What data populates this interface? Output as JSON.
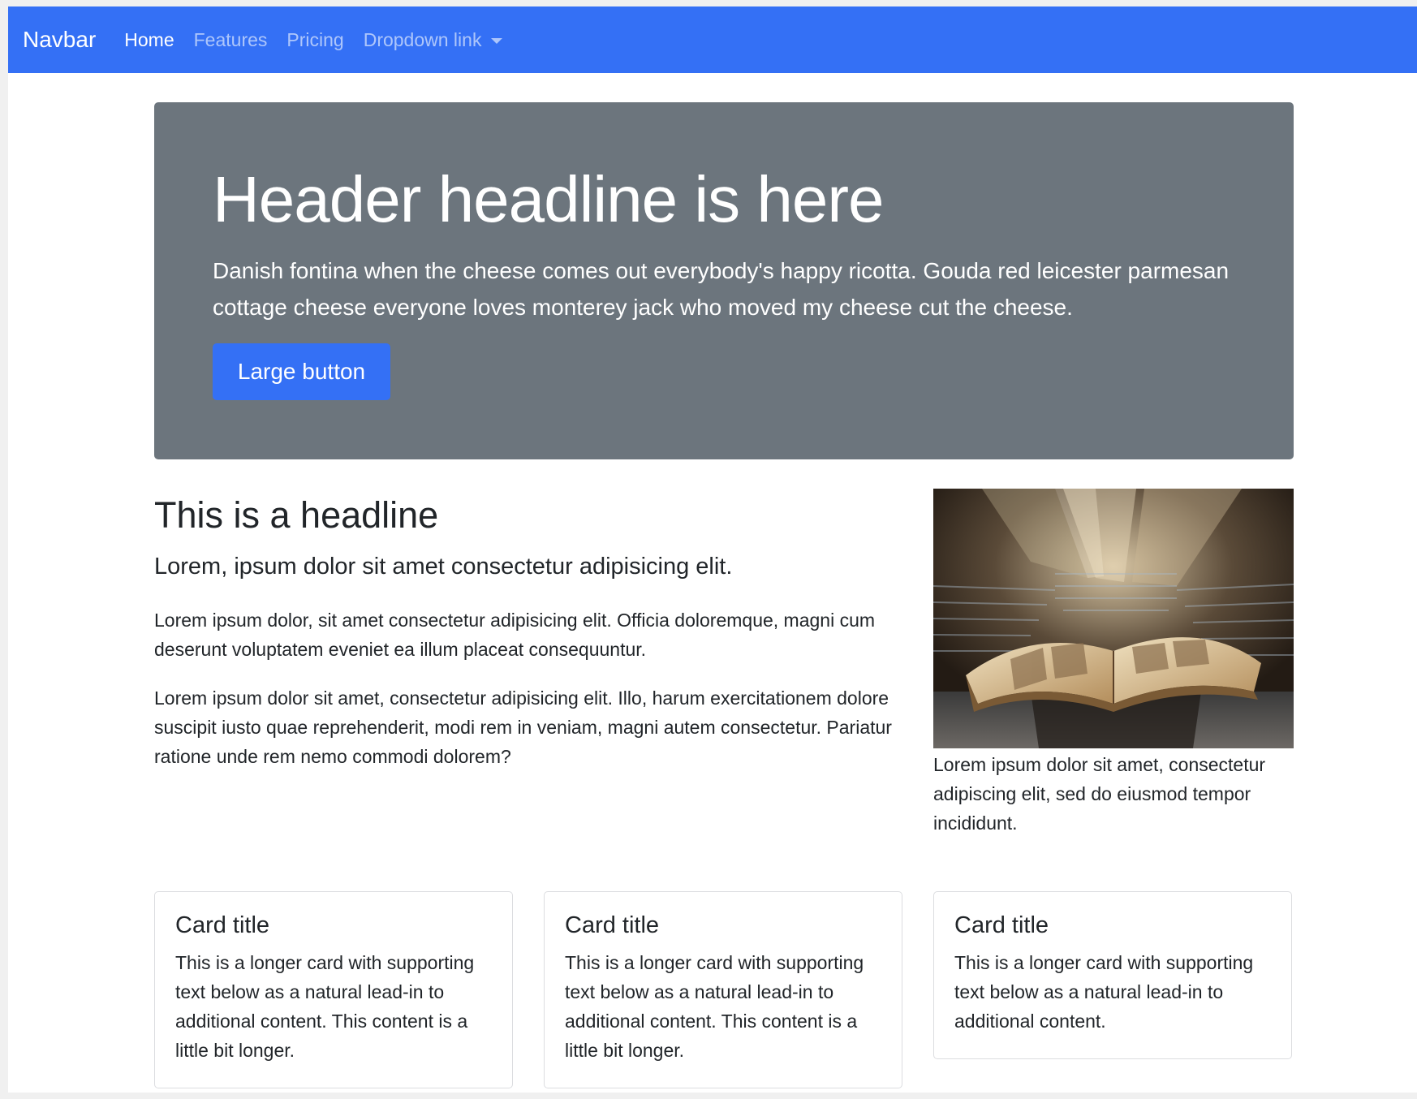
{
  "navbar": {
    "brand": "Navbar",
    "background_color": "#3470f5",
    "links": [
      {
        "label": "Home",
        "active": true
      },
      {
        "label": "Features",
        "active": false
      },
      {
        "label": "Pricing",
        "active": false
      },
      {
        "label": "Dropdown link",
        "active": false,
        "dropdown": true
      }
    ],
    "dropdown_icon": "caret-down-icon"
  },
  "hero": {
    "title": "Header headline is here",
    "lead": "Danish fontina when the cheese comes out everybody's happy ricotta. Gouda red leicester parmesan cottage cheese everyone loves monterey jack who moved my cheese cut the cheese.",
    "button_label": "Large button",
    "background_color": "#6c757d"
  },
  "article": {
    "headline": "This is a headline",
    "lead": "Lorem, ipsum dolor sit amet consectetur adipisicing elit.",
    "paragraphs": [
      "Lorem ipsum dolor, sit amet consectetur adipisicing elit. Officia doloremque, magni cum deserunt voluptatem eveniet ea illum placeat consequuntur.",
      "Lorem ipsum dolor sit amet, consectetur adipisicing elit. Illo, harum exercitationem dolore suscipit iusto quae reprehenderit, modi rem in veniam, magni autem consectetur. Pariatur ratione unde rem nemo commodi dolorem?"
    ]
  },
  "figure": {
    "image": "open-book-photo",
    "caption": "Lorem ipsum dolor sit amet, consectetur adipiscing elit, sed do eiusmod tempor incididunt."
  },
  "cards": [
    {
      "title": "Card title",
      "text": "This is a longer card with supporting text below as a natural lead-in to additional content. This content is a little bit longer."
    },
    {
      "title": "Card title",
      "text": "This is a longer card with supporting text below as a natural lead-in to additional content. This content is a little bit longer."
    },
    {
      "title": "Card title",
      "text": "This is a longer card with supporting text below as a natural lead-in to additional content."
    }
  ]
}
